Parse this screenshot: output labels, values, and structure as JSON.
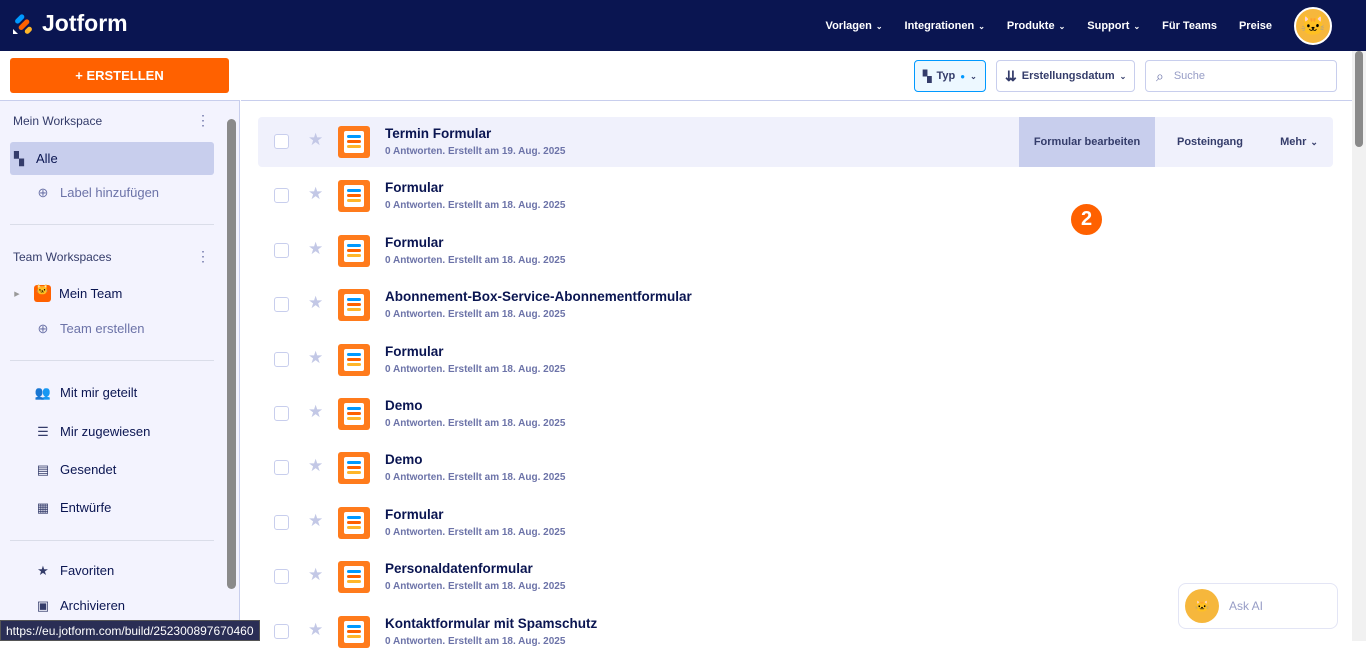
{
  "brand": "Jotform",
  "nav": [
    {
      "label": "Vorlagen",
      "dd": true
    },
    {
      "label": "Integrationen",
      "dd": true
    },
    {
      "label": "Produkte",
      "dd": true
    },
    {
      "label": "Support",
      "dd": true
    },
    {
      "label": "Für Teams",
      "dd": false
    },
    {
      "label": "Preise",
      "dd": false
    }
  ],
  "sidebar": {
    "create": "+ ERSTELLEN",
    "my_ws": "Mein Workspace",
    "all": "Alle",
    "add_label": "Label hinzufügen",
    "team_ws": "Team Workspaces",
    "my_team": "Mein Team",
    "create_team": "Team erstellen",
    "shared": "Mit mir geteilt",
    "assigned": "Mir zugewiesen",
    "sent": "Gesendet",
    "drafts": "Entwürfe",
    "favorites": "Favoriten",
    "archive": "Archivieren"
  },
  "toolbar": {
    "type": "Typ",
    "sort": "Erstellungsdatum",
    "search_placeholder": "Suche"
  },
  "row_actions": {
    "edit": "Formular bearbeiten",
    "inbox": "Posteingang",
    "more": "Mehr"
  },
  "step_badge": "2",
  "forms": [
    {
      "title": "Termin Formular",
      "meta": "0 Antworten. Erstellt am 19. Aug. 2025"
    },
    {
      "title": "Formular",
      "meta": "0 Antworten. Erstellt am 18. Aug. 2025"
    },
    {
      "title": "Formular",
      "meta": "0 Antworten. Erstellt am 18. Aug. 2025"
    },
    {
      "title": "Abonnement-Box-Service-Abonnementformular",
      "meta": "0 Antworten. Erstellt am 18. Aug. 2025"
    },
    {
      "title": "Formular",
      "meta": "0 Antworten. Erstellt am 18. Aug. 2025"
    },
    {
      "title": "Demo",
      "meta": "0 Antworten. Erstellt am 18. Aug. 2025"
    },
    {
      "title": "Demo",
      "meta": "0 Antworten. Erstellt am 18. Aug. 2025"
    },
    {
      "title": "Formular",
      "meta": "0 Antworten. Erstellt am 18. Aug. 2025"
    },
    {
      "title": "Personaldatenformular",
      "meta": "0 Antworten. Erstellt am 18. Aug. 2025"
    },
    {
      "title": "Kontaktformular mit Spamschutz",
      "meta": "0 Antworten. Erstellt am 18. Aug. 2025"
    }
  ],
  "ask_ai": "Ask AI",
  "status_url": "https://eu.jotform.com/build/252300897670460"
}
